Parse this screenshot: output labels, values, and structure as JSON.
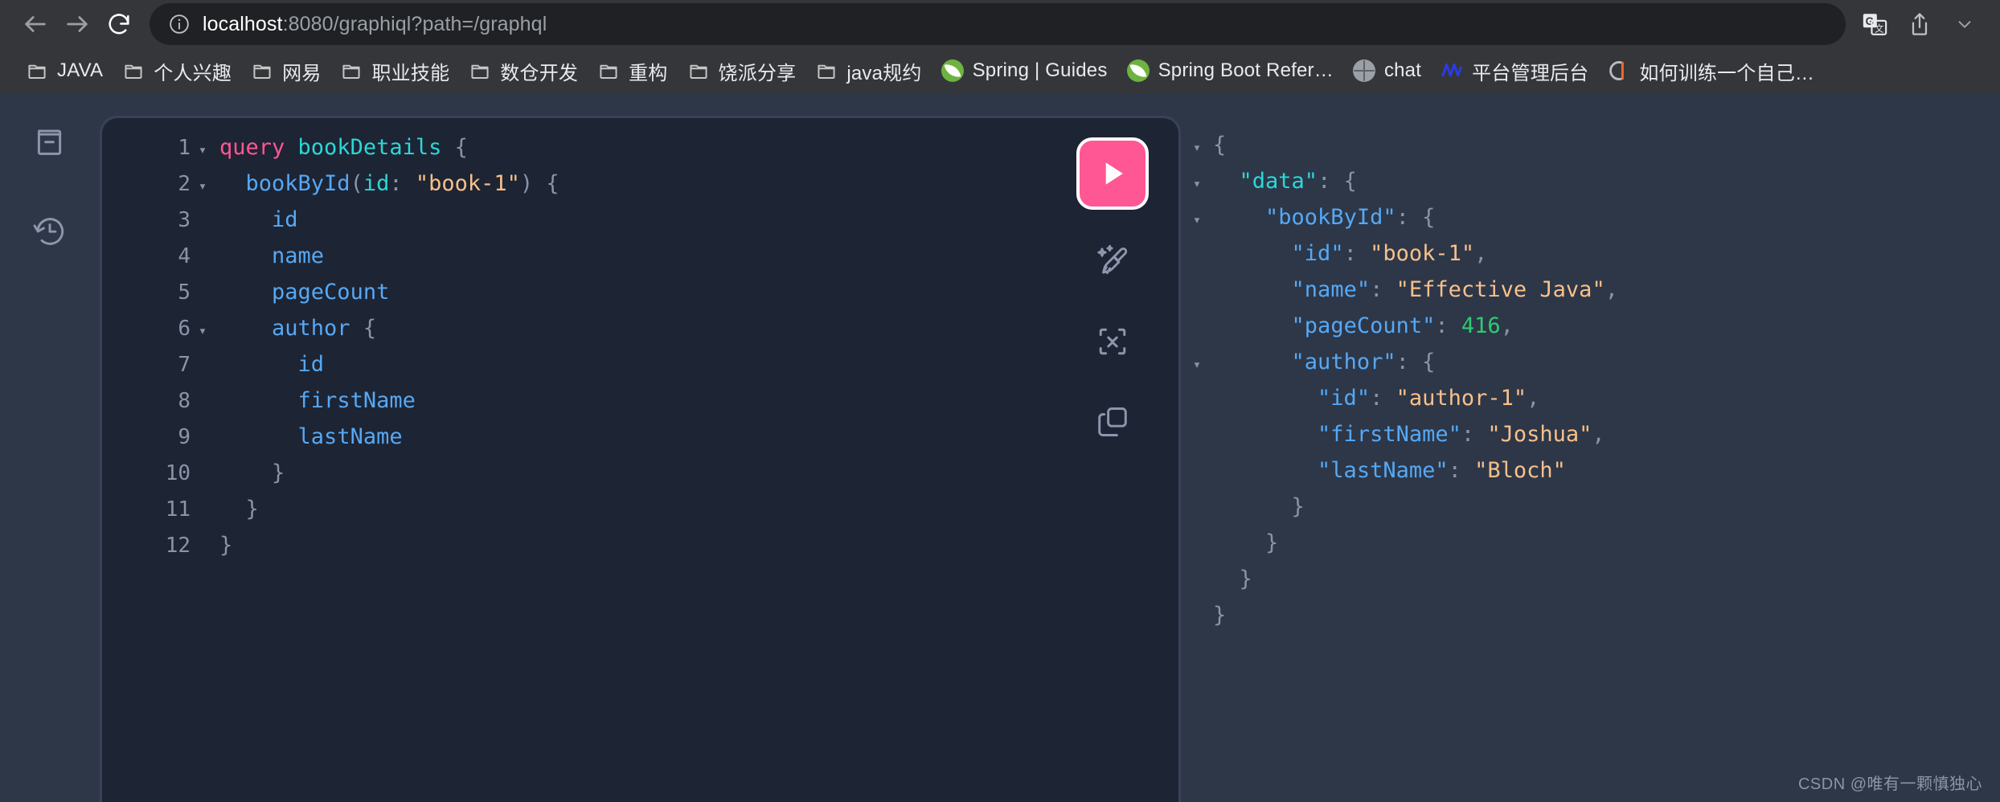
{
  "browser": {
    "back_label": "Back",
    "forward_label": "Forward",
    "reload_label": "Reload",
    "site_info_label": "View site information",
    "url_host": "localhost",
    "url_rest": ":8080/graphiql?path=/graphql",
    "url_full": "localhost:8080/graphiql?path=/graphql",
    "translate_label": "Translate this page",
    "share_label": "Share this page",
    "chrome_bg": "#35363a",
    "omnibox_bg": "#202124"
  },
  "bookmarks": [
    {
      "label": "JAVA",
      "icon": "folder-icon",
      "type": "folder"
    },
    {
      "label": "个人兴趣",
      "icon": "folder-icon",
      "type": "folder"
    },
    {
      "label": "网易",
      "icon": "folder-icon",
      "type": "folder"
    },
    {
      "label": "职业技能",
      "icon": "folder-icon",
      "type": "folder"
    },
    {
      "label": "数仓开发",
      "icon": "folder-icon",
      "type": "folder"
    },
    {
      "label": "重构",
      "icon": "folder-icon",
      "type": "folder"
    },
    {
      "label": "饶派分享",
      "icon": "folder-icon",
      "type": "folder"
    },
    {
      "label": "java规约",
      "icon": "folder-icon",
      "type": "folder"
    },
    {
      "label": "Spring | Guides",
      "icon": "spring-favicon",
      "type": "link"
    },
    {
      "label": "Spring Boot Refer…",
      "icon": "spring-favicon",
      "type": "link"
    },
    {
      "label": "chat",
      "icon": "globe-favicon",
      "type": "link"
    },
    {
      "label": "平台管理后台",
      "icon": "chart-favicon",
      "type": "link"
    },
    {
      "label": "如何训练一个自己…",
      "icon": "tool-favicon",
      "type": "link"
    }
  ],
  "graphiql": {
    "sidebar": [
      {
        "name": "docs-button",
        "icon": "book-icon",
        "label": "Show Documentation Explorer"
      },
      {
        "name": "history-button",
        "icon": "history-icon",
        "label": "Show History"
      }
    ],
    "toolbar": [
      {
        "name": "execute-query-button",
        "icon": "play-icon",
        "label": "Execute query",
        "color": "#ff5794"
      },
      {
        "name": "prettify-button",
        "icon": "prettify-icon",
        "label": "Prettify query"
      },
      {
        "name": "merge-fragments-button",
        "icon": "merge-icon",
        "label": "Merge fragments into query"
      },
      {
        "name": "copy-query-button",
        "icon": "copy-icon",
        "label": "Copy query"
      }
    ],
    "editor": {
      "lines": [
        {
          "n": "1",
          "fold": "▾",
          "segments": [
            {
              "t": "kw",
              "v": "query"
            },
            {
              "t": "punc",
              "v": " "
            },
            {
              "t": "def",
              "v": "bookDetails"
            },
            {
              "t": "punc",
              "v": " {"
            }
          ]
        },
        {
          "n": "2",
          "fold": "▾",
          "segments": [
            {
              "t": "punc",
              "v": "  "
            },
            {
              "t": "field",
              "v": "bookById"
            },
            {
              "t": "punc",
              "v": "("
            },
            {
              "t": "arg",
              "v": "id"
            },
            {
              "t": "punc",
              "v": ": "
            },
            {
              "t": "str",
              "v": "\"book-1\""
            },
            {
              "t": "punc",
              "v": ") {"
            }
          ]
        },
        {
          "n": "3",
          "fold": "",
          "segments": [
            {
              "t": "punc",
              "v": "    "
            },
            {
              "t": "field",
              "v": "id"
            }
          ]
        },
        {
          "n": "4",
          "fold": "",
          "segments": [
            {
              "t": "punc",
              "v": "    "
            },
            {
              "t": "field",
              "v": "name"
            }
          ]
        },
        {
          "n": "5",
          "fold": "",
          "segments": [
            {
              "t": "punc",
              "v": "    "
            },
            {
              "t": "field",
              "v": "pageCount"
            }
          ]
        },
        {
          "n": "6",
          "fold": "▾",
          "segments": [
            {
              "t": "punc",
              "v": "    "
            },
            {
              "t": "field",
              "v": "author"
            },
            {
              "t": "punc",
              "v": " {"
            }
          ]
        },
        {
          "n": "7",
          "fold": "",
          "segments": [
            {
              "t": "punc",
              "v": "      "
            },
            {
              "t": "field",
              "v": "id"
            }
          ]
        },
        {
          "n": "8",
          "fold": "",
          "segments": [
            {
              "t": "punc",
              "v": "      "
            },
            {
              "t": "field",
              "v": "firstName"
            }
          ]
        },
        {
          "n": "9",
          "fold": "",
          "segments": [
            {
              "t": "punc",
              "v": "      "
            },
            {
              "t": "field",
              "v": "lastName"
            }
          ]
        },
        {
          "n": "10",
          "fold": "",
          "segments": [
            {
              "t": "punc",
              "v": "    }"
            }
          ]
        },
        {
          "n": "11",
          "fold": "",
          "segments": [
            {
              "t": "punc",
              "v": "  }"
            }
          ]
        },
        {
          "n": "12",
          "fold": "",
          "segments": [
            {
              "t": "punc",
              "v": "}"
            }
          ]
        }
      ],
      "raw_query": "query bookDetails {\n  bookById(id: \"book-1\") {\n    id\n    name\n    pageCount\n    author {\n      id\n      firstName\n      lastName\n    }\n  }\n}"
    },
    "response": {
      "lines": [
        {
          "fold": "▾",
          "segments": [
            {
              "t": "punc",
              "v": "{"
            }
          ]
        },
        {
          "fold": "▾",
          "segments": [
            {
              "t": "punc",
              "v": "  "
            },
            {
              "t": "datakey",
              "v": "\"data\""
            },
            {
              "t": "punc",
              "v": ": {"
            }
          ]
        },
        {
          "fold": "▾",
          "segments": [
            {
              "t": "punc",
              "v": "    "
            },
            {
              "t": "key",
              "v": "\"bookById\""
            },
            {
              "t": "punc",
              "v": ": {"
            }
          ]
        },
        {
          "fold": "",
          "segments": [
            {
              "t": "punc",
              "v": "      "
            },
            {
              "t": "key",
              "v": "\"id\""
            },
            {
              "t": "punc",
              "v": ": "
            },
            {
              "t": "str",
              "v": "\"book-1\""
            },
            {
              "t": "punc",
              "v": ","
            }
          ]
        },
        {
          "fold": "",
          "segments": [
            {
              "t": "punc",
              "v": "      "
            },
            {
              "t": "key",
              "v": "\"name\""
            },
            {
              "t": "punc",
              "v": ": "
            },
            {
              "t": "str",
              "v": "\"Effective Java\""
            },
            {
              "t": "punc",
              "v": ","
            }
          ]
        },
        {
          "fold": "",
          "segments": [
            {
              "t": "punc",
              "v": "      "
            },
            {
              "t": "key",
              "v": "\"pageCount\""
            },
            {
              "t": "punc",
              "v": ": "
            },
            {
              "t": "num",
              "v": "416"
            },
            {
              "t": "punc",
              "v": ","
            }
          ]
        },
        {
          "fold": "▾",
          "segments": [
            {
              "t": "punc",
              "v": "      "
            },
            {
              "t": "key",
              "v": "\"author\""
            },
            {
              "t": "punc",
              "v": ": {"
            }
          ]
        },
        {
          "fold": "",
          "segments": [
            {
              "t": "punc",
              "v": "        "
            },
            {
              "t": "key",
              "v": "\"id\""
            },
            {
              "t": "punc",
              "v": ": "
            },
            {
              "t": "str",
              "v": "\"author-1\""
            },
            {
              "t": "punc",
              "v": ","
            }
          ]
        },
        {
          "fold": "",
          "segments": [
            {
              "t": "punc",
              "v": "        "
            },
            {
              "t": "key",
              "v": "\"firstName\""
            },
            {
              "t": "punc",
              "v": ": "
            },
            {
              "t": "str",
              "v": "\"Joshua\""
            },
            {
              "t": "punc",
              "v": ","
            }
          ]
        },
        {
          "fold": "",
          "segments": [
            {
              "t": "punc",
              "v": "        "
            },
            {
              "t": "key",
              "v": "\"lastName\""
            },
            {
              "t": "punc",
              "v": ": "
            },
            {
              "t": "str",
              "v": "\"Bloch\""
            }
          ]
        },
        {
          "fold": "",
          "segments": [
            {
              "t": "punc",
              "v": "      }"
            }
          ]
        },
        {
          "fold": "",
          "segments": [
            {
              "t": "punc",
              "v": "    }"
            }
          ]
        },
        {
          "fold": "",
          "segments": [
            {
              "t": "punc",
              "v": "  }"
            }
          ]
        },
        {
          "fold": "",
          "segments": [
            {
              "t": "punc",
              "v": "}"
            }
          ]
        }
      ],
      "values": {
        "data.bookById.id": "book-1",
        "data.bookById.name": "Effective Java",
        "data.bookById.pageCount": 416,
        "data.bookById.author.id": "author-1",
        "data.bookById.author.firstName": "Joshua",
        "data.bookById.author.lastName": "Bloch"
      }
    }
  },
  "watermark": {
    "text": "CSDN @唯有一颗慎独心"
  },
  "colors": {
    "app_bg": "#2d3748",
    "editor_bg": "#1d2433",
    "editor_border": "#39415a",
    "accent_pink": "#ff5794",
    "keyword": "#ff5794",
    "definition": "#2ad8d8",
    "field": "#56a8f5",
    "string": "#f9c08a",
    "number": "#2ecc71",
    "punctuation": "#8b93a7"
  }
}
